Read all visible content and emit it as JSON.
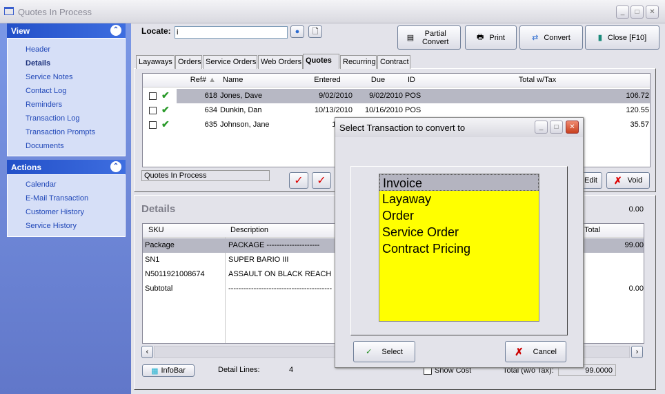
{
  "window": {
    "title": "Quotes In Process"
  },
  "sidebar": {
    "view": {
      "title": "View",
      "items": [
        "Header",
        "Details",
        "Service Notes",
        "Contact Log",
        "Reminders",
        "Transaction Log",
        "Transaction Prompts",
        "Documents"
      ],
      "active": "Details"
    },
    "actions": {
      "title": "Actions",
      "items": [
        "Calendar",
        "E-Mail Transaction",
        "Customer History",
        "Service History"
      ]
    }
  },
  "toolbar": {
    "locate_label": "Locate:",
    "locate_value": "i",
    "partial_convert": "Partial Convert",
    "print": "Print",
    "convert": "Convert",
    "close": "Close [F10]"
  },
  "tabs": [
    {
      "label": "Layaways"
    },
    {
      "label": "Orders"
    },
    {
      "label": "Service Orders"
    },
    {
      "label": "Web Orders"
    },
    {
      "label": "Quotes",
      "active": true
    },
    {
      "label": "Recurring"
    },
    {
      "label": "Contract"
    }
  ],
  "quotes": {
    "columns": [
      "Ref#",
      "Name",
      "Entered",
      "Due",
      "ID",
      "Total w/Tax"
    ],
    "rows": [
      {
        "ref": "618",
        "name": "Jones, Dave",
        "entered": "9/02/2010",
        "due": "9/02/2010",
        "id": "POS",
        "total": "106.72",
        "selected": true
      },
      {
        "ref": "634",
        "name": "Dunkin, Dan",
        "entered": "10/13/2010",
        "due": "10/16/2010",
        "id": "POS",
        "total": "120.55"
      },
      {
        "ref": "635",
        "name": "Johnson, Jane",
        "entered": "11/10/",
        "due": "",
        "id": "",
        "total": "35.57"
      }
    ],
    "status": "Quotes In Process",
    "edit": "Edit",
    "void": "Void"
  },
  "details": {
    "title": "Details",
    "top_value": "0.00",
    "columns": [
      "SKU",
      "Description",
      "Total"
    ],
    "rows": [
      {
        "sku": "Package",
        "desc": "PACKAGE ---------------------",
        "total": "99.00",
        "selected": true
      },
      {
        "sku": "SN1",
        "desc": "SUPER BARIO III",
        "total": ""
      },
      {
        "sku": "N5011921008674",
        "desc": "ASSAULT ON BLACK REACH",
        "total": ""
      },
      {
        "sku": "Subtotal",
        "desc": "-----------------------------------------",
        "total": "0.00"
      }
    ],
    "infobar": "InfoBar",
    "detail_lines_label": "Detail Lines:",
    "detail_lines": "4",
    "show_cost": "Show Cost",
    "total_label": "Total (w/o Tax):",
    "total_value": "99.0000"
  },
  "dialog": {
    "title": "Select Transaction to convert to",
    "options": [
      "Invoice",
      "Layaway",
      "Order",
      "Service Order",
      "Contract Pricing"
    ],
    "selected": "Invoice",
    "select": "Select",
    "cancel": "Cancel",
    "list_color": "#ffff00"
  }
}
